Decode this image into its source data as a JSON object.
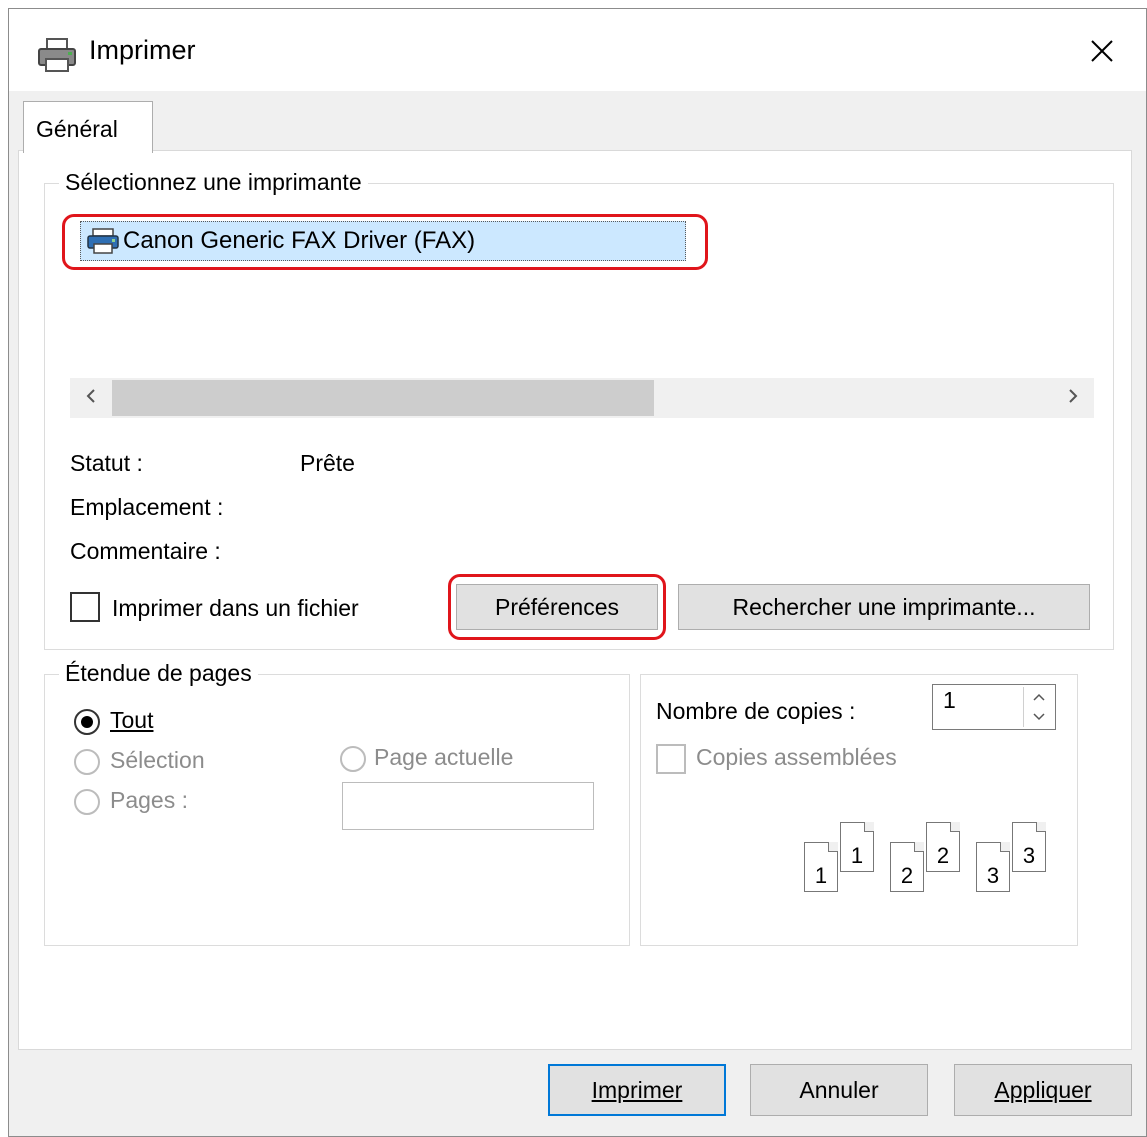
{
  "window": {
    "title": "Imprimer",
    "icon": "printer-icon",
    "close_icon": "close-icon"
  },
  "tabs": [
    {
      "label": "Général",
      "active": true
    }
  ],
  "printer_group": {
    "title": "Sélectionnez une imprimante",
    "printers": [
      {
        "name": "Canon Generic FAX Driver (FAX)",
        "selected": true,
        "icon": "fax-printer-icon"
      }
    ],
    "scroll_left": "<",
    "scroll_right": ">",
    "status_label": "Statut :",
    "status_value": "Prête",
    "location_label": "Emplacement :",
    "location_value": "",
    "comment_label": "Commentaire :",
    "comment_value": "",
    "print_to_file_label": "Imprimer dans un fichier",
    "print_to_file_checked": false,
    "preferences_button": "Préférences",
    "find_printer_button": "Rechercher une imprimante..."
  },
  "page_range": {
    "title": "Étendue de pages",
    "all_label": "Tout",
    "all_selected": true,
    "selection_label": "Sélection",
    "current_page_label": "Page actuelle",
    "pages_label": "Pages :",
    "pages_value": ""
  },
  "copies": {
    "count_label": "Nombre de copies :",
    "count_value": "1",
    "collate_label": "Copies assemblées",
    "collate_checked": false,
    "collate_pages": [
      "1",
      "1",
      "2",
      "2",
      "3",
      "3"
    ]
  },
  "footer": {
    "print_button": "Imprimer",
    "cancel_button": "Annuler",
    "apply_button": "Appliquer"
  },
  "colors": {
    "highlight_outline": "#e0151b",
    "selection_bg": "#cce8ff",
    "default_button_border": "#0078d7"
  }
}
